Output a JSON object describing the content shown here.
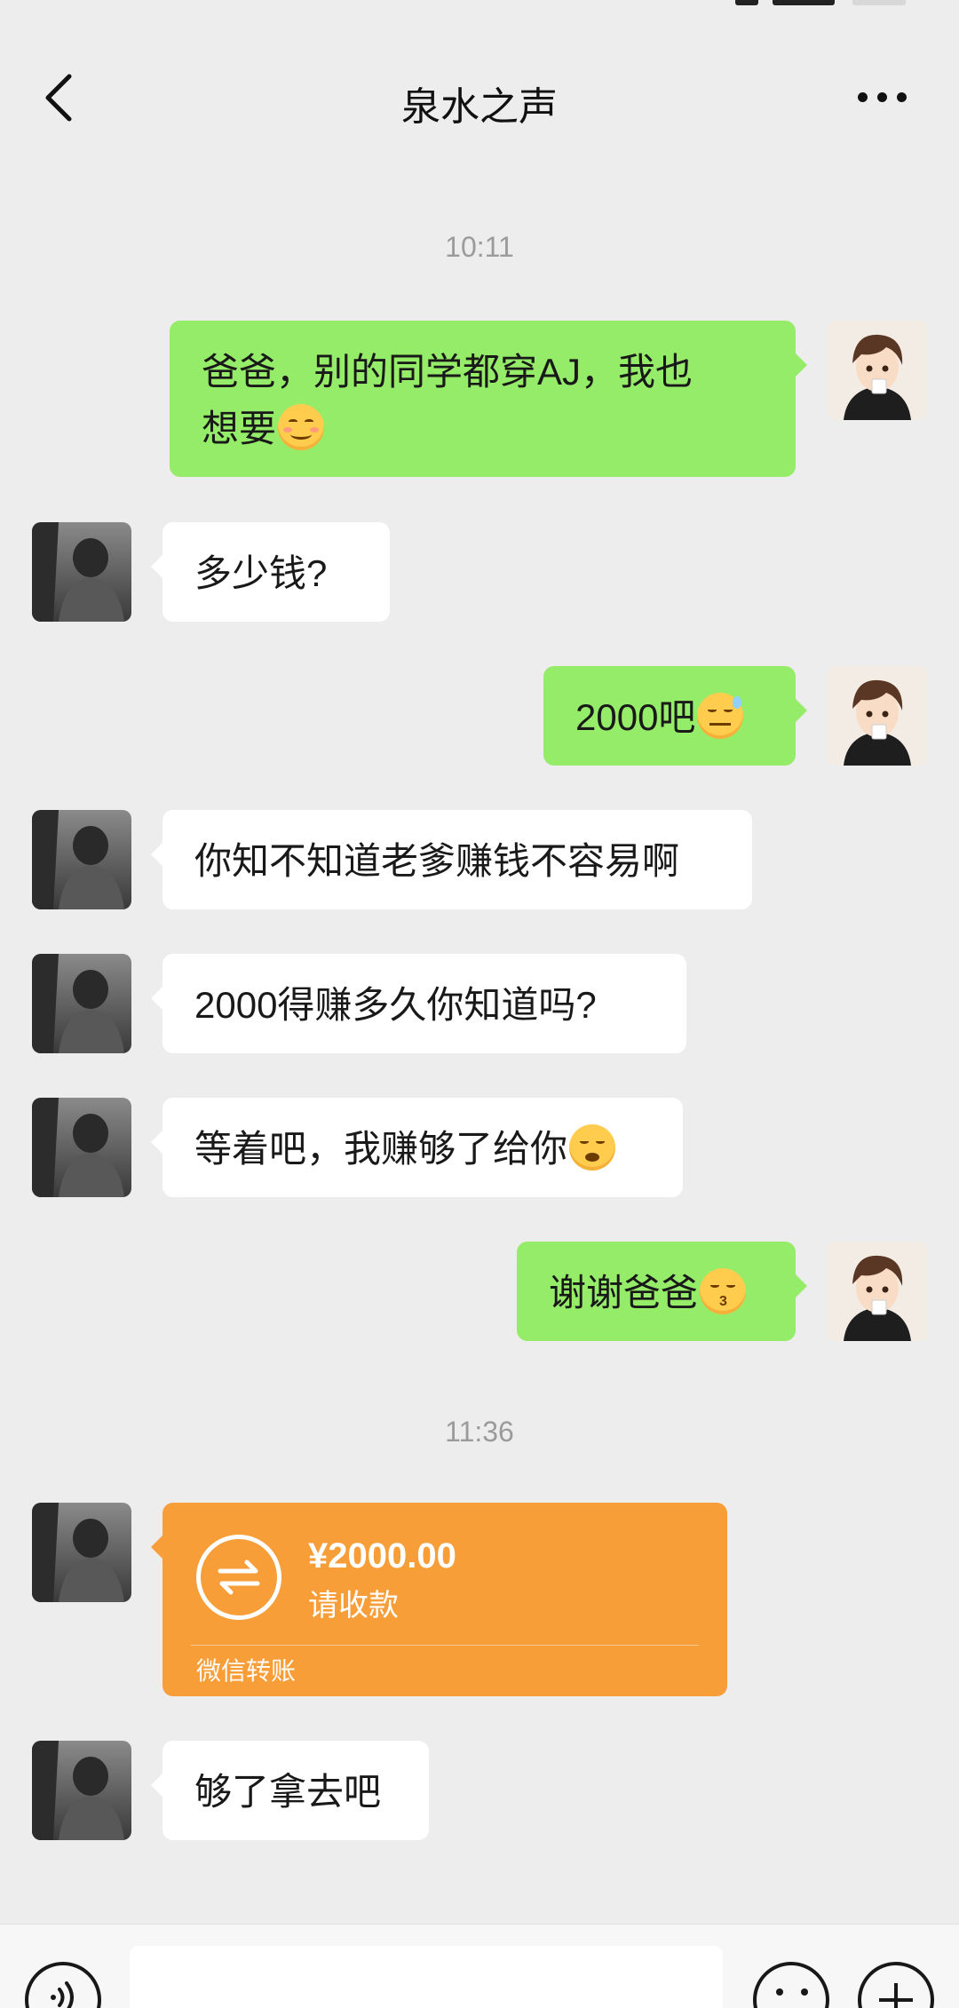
{
  "header": {
    "title": "泉水之声"
  },
  "colors": {
    "accent_green": "#95ec69",
    "transfer_orange": "#f79e39",
    "background": "#ededed"
  },
  "icons": {
    "back": "chevron-left-icon",
    "more": "more-dots-icon",
    "transfer": "exchange-icon",
    "voice": "voice-icon",
    "emoji": "emoji-icon",
    "plus": "plus-icon"
  },
  "messages": {
    "time_1": "10:11",
    "m1": {
      "sender": "me",
      "text_l1": "爸爸，别的同学都穿AJ，我也",
      "text_l2": "想要",
      "emoji": "smiling-face-icon"
    },
    "m2": {
      "sender": "other",
      "text": "多少钱?"
    },
    "m3": {
      "sender": "me",
      "text": "2000吧",
      "emoji": "sweat-smile-icon"
    },
    "m4": {
      "sender": "other",
      "text": "你知不知道老爹赚钱不容易啊"
    },
    "m5": {
      "sender": "other",
      "text": "2000得赚多久你知道吗?"
    },
    "m6": {
      "sender": "other",
      "text": "等着吧，我赚够了给你",
      "emoji": "sad-face-icon"
    },
    "m7": {
      "sender": "me",
      "text": "谢谢爸爸",
      "emoji": "kiss-face-icon"
    },
    "time_2": "11:36",
    "transfer": {
      "amount": "¥2000.00",
      "status": "请收款",
      "source": "微信转账"
    },
    "m8": {
      "sender": "other",
      "text": "够了拿去吧"
    }
  },
  "input": {
    "value": ""
  }
}
